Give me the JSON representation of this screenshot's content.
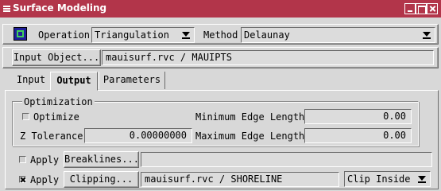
{
  "window": {
    "title": "Surface Modeling"
  },
  "toolbar": {
    "operation_label": "Operation",
    "operation_value": "Triangulation",
    "method_label": "Method",
    "method_value": "Delaunay"
  },
  "input": {
    "button_label": "Input Object...",
    "object_value": "mauisurf.rvc / MAUIPTS"
  },
  "tabs": [
    {
      "label": "Input"
    },
    {
      "label": "Output"
    },
    {
      "label": "Parameters"
    }
  ],
  "optimization": {
    "group_label": "Optimization",
    "optimize_label": "Optimize",
    "optimize_checked": false,
    "ztol_label": "Z Tolerance",
    "ztol_value": "0.00000000",
    "min_edge_label": "Minimum Edge Length",
    "min_edge_value": "0.00",
    "max_edge_label": "Maximum Edge Length",
    "max_edge_value": "0.00"
  },
  "breaklines": {
    "apply_label": "Apply",
    "apply_checked": false,
    "button_label": "Breaklines...",
    "value": ""
  },
  "clipping": {
    "apply_label": "Apply",
    "apply_checked": true,
    "button_label": "Clipping...",
    "value": "mauisurf.rvc / SHORELINE",
    "mode_value": "Clip Inside"
  },
  "colors": {
    "titlebar": "#b2354a",
    "background": "#d8d8d8"
  }
}
